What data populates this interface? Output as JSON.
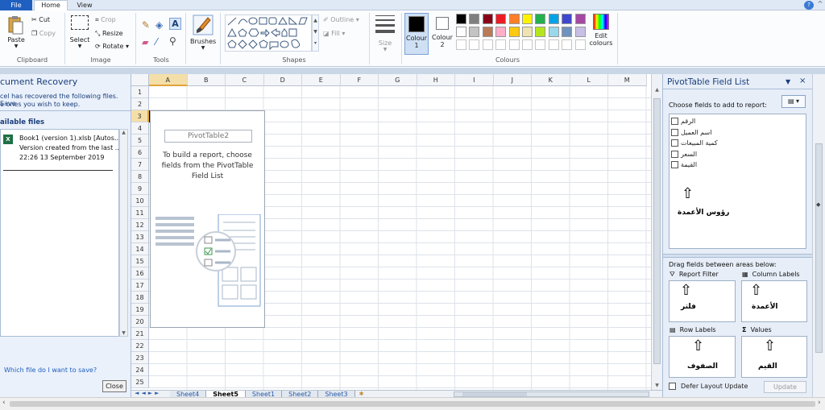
{
  "tabs": {
    "file": "File",
    "home": "Home",
    "view": "View"
  },
  "window": {
    "help": "?",
    "minimize": "^"
  },
  "ribbon": {
    "clipboard": {
      "paste": "Paste",
      "cut": "Cut",
      "copy": "Copy",
      "label": "Clipboard"
    },
    "image": {
      "select": "Select",
      "crop": "Crop",
      "resize": "Resize",
      "rotate": "Rotate",
      "label": "Image"
    },
    "tools": {
      "label": "Tools"
    },
    "brushes": {
      "label": "Brushes"
    },
    "shapes": {
      "outline": "Outline",
      "fill": "Fill",
      "label": "Shapes"
    },
    "size": {
      "label": "Size"
    },
    "colour1": {
      "line1": "Colour",
      "line2": "1"
    },
    "colour2": {
      "line1": "Colour",
      "line2": "2"
    },
    "edit_colours": {
      "line1": "Edit",
      "line2": "colours"
    },
    "colours": {
      "label": "Colours"
    },
    "palette_row1": [
      "#000000",
      "#7f7f7f",
      "#880015",
      "#ed1c24",
      "#ff7f27",
      "#fff200",
      "#22b14c",
      "#00a2e8",
      "#3f48cc",
      "#a349a4"
    ],
    "palette_row2": [
      "#ffffff",
      "#c3c3c3",
      "#b97a57",
      "#ffaec9",
      "#ffc90e",
      "#efe4b0",
      "#b5e61d",
      "#99d9ea",
      "#7092be",
      "#c8bfe7"
    ]
  },
  "recovery": {
    "title": "cument Recovery",
    "desc_line1": "cel has recovered the following files.  Save",
    "desc_line2": "e ones you wish to keep.",
    "available": "ailable files",
    "file_name": "Book1 (version 1).xlsb  [Autos...",
    "file_desc": "Version created from the last ...",
    "file_time": "22:26 13 September 2019",
    "which_link": "Which file do I want to save?",
    "close_button": "Close"
  },
  "sheet": {
    "columns": [
      "A",
      "B",
      "C",
      "D",
      "E",
      "F",
      "G",
      "H",
      "I",
      "J",
      "K",
      "L",
      "M"
    ],
    "rows": [
      "1",
      "2",
      "3",
      "4",
      "5",
      "6",
      "7",
      "8",
      "9",
      "10",
      "11",
      "12",
      "13",
      "14",
      "15",
      "16",
      "17",
      "18",
      "19",
      "20",
      "21",
      "22",
      "23",
      "24",
      "25"
    ],
    "pivot_name": "PivotTable2",
    "pivot_hint_line1": "To build a report, choose",
    "pivot_hint_line2": "fields from the PivotTable",
    "pivot_hint_line3": "Field List"
  },
  "sheet_tabs": [
    "Sheet4",
    "Sheet5",
    "Sheet1",
    "Sheet2",
    "Sheet3"
  ],
  "field_list": {
    "title": "PivotTable Field List",
    "choose_label": "Choose fields to add to report:",
    "fields": [
      "الرقم",
      "اسم العميل",
      "كمية المبيعات",
      "السعر",
      "القيمة"
    ],
    "column_heads_note": "رؤوس الأعمدة",
    "drag_label": "Drag fields between areas below:",
    "report_filter": "Report Filter",
    "column_labels": "Column Labels",
    "row_labels": "Row Labels",
    "values": "Values",
    "filter_note": "فلتر",
    "columns_note": "الأعمدة",
    "rows_note": "الصفوف",
    "values_note": "القيم",
    "defer_label": "Defer Layout Update",
    "update_button": "Update"
  },
  "icons": [
    "paste-icon",
    "cut-icon",
    "copy-icon",
    "select-icon",
    "crop-icon",
    "resize-icon",
    "rotate-icon",
    "pencil-icon",
    "fill-icon",
    "text-icon",
    "eraser-icon",
    "picker-icon",
    "magnifier-icon",
    "brush-icon",
    "close-icon",
    "dropdown-icon",
    "excel-file-icon",
    "filter-icon",
    "columns-icon",
    "rows-icon",
    "sigma-icon",
    "arrow-up-icon"
  ]
}
